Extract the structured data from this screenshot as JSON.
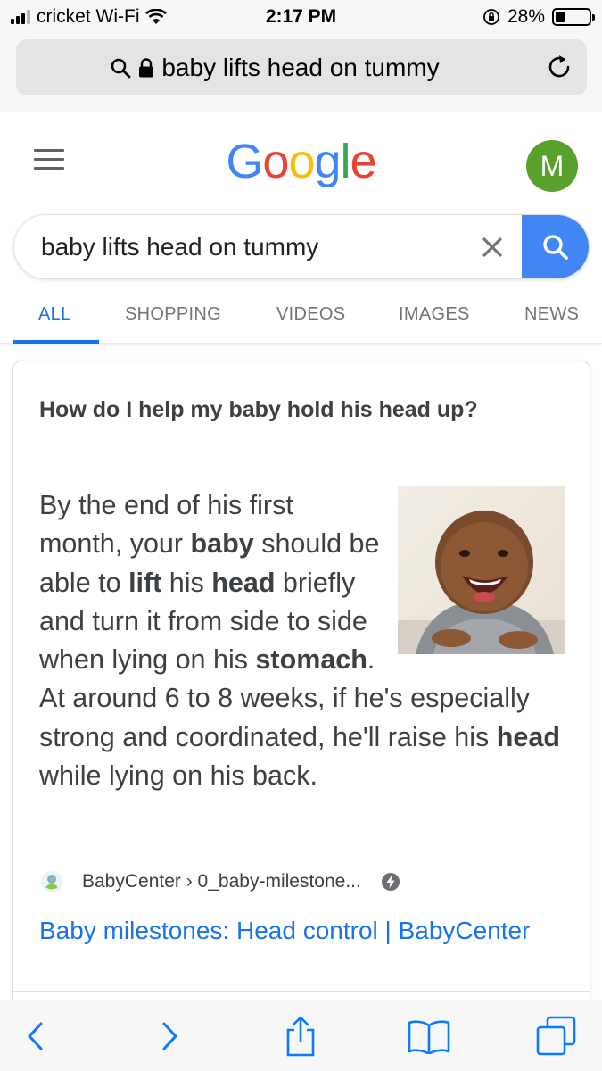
{
  "status_bar": {
    "carrier": "cricket Wi-Fi",
    "time": "2:17 PM",
    "battery": "28%",
    "battery_level": 0.28
  },
  "url_bar": {
    "text": "baby lifts head on tummy"
  },
  "google": {
    "logo_letters": [
      "G",
      "o",
      "o",
      "g",
      "l",
      "e"
    ],
    "avatar_initial": "M"
  },
  "search": {
    "query": "baby lifts head on tummy"
  },
  "tabs": [
    {
      "label": "ALL",
      "active": true
    },
    {
      "label": "SHOPPING",
      "active": false
    },
    {
      "label": "VIDEOS",
      "active": false
    },
    {
      "label": "IMAGES",
      "active": false
    },
    {
      "label": "NEWS",
      "active": false
    }
  ],
  "result": {
    "question": "How do I help my baby hold his head up?",
    "answer": [
      {
        "t": "By the end of his first month, your ",
        "b": false
      },
      {
        "t": "baby",
        "b": true
      },
      {
        "t": " should be able to ",
        "b": false
      },
      {
        "t": "lift",
        "b": true
      },
      {
        "t": " his ",
        "b": false
      },
      {
        "t": "head",
        "b": true
      },
      {
        "t": " briefly and turn it from side to side when lying on his ",
        "b": false
      },
      {
        "t": "stomach",
        "b": true
      },
      {
        "t": ". At around 6 to 8 weeks, if he's especially strong and coordinated, he'll raise his ",
        "b": false
      },
      {
        "t": "head",
        "b": true
      },
      {
        "t": " while lying on his back.",
        "b": false
      }
    ],
    "source": "BabyCenter › 0_baby-milestone...",
    "link_title": "Baby milestones: Head control | BabyCenter"
  },
  "colors": {
    "google_blue": "#4285F4",
    "link_blue": "#1a73e8",
    "avatar_green": "#5aa02c"
  }
}
